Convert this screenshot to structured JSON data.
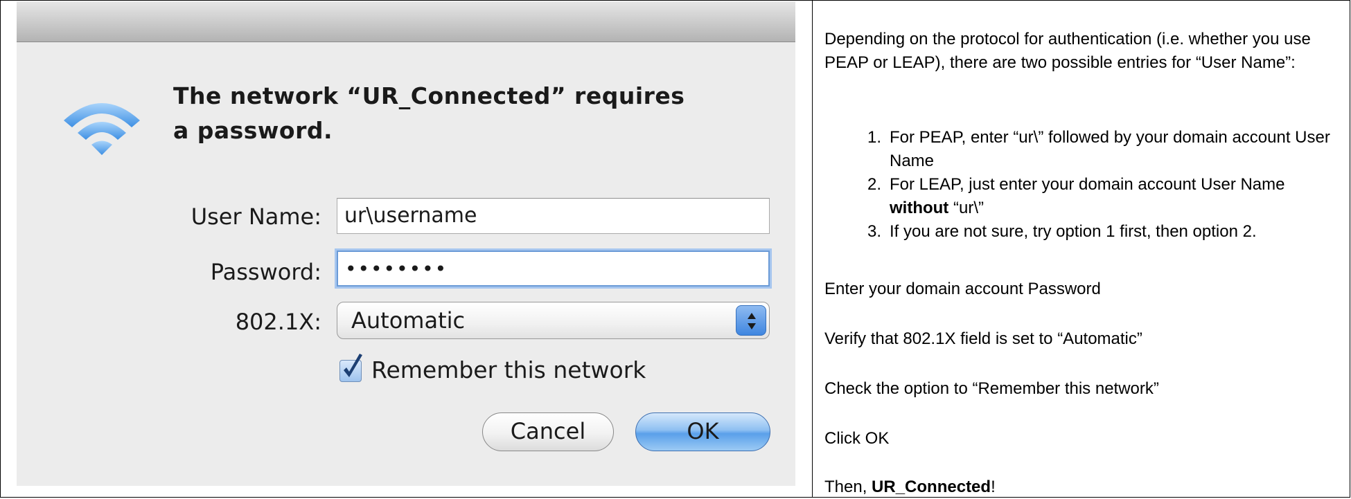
{
  "dialog": {
    "title": "The network “UR_Connected” requires a password.",
    "username_label": "User Name:",
    "username_value": "ur\\username",
    "password_label": "Password:",
    "password_value": "••••••••",
    "dot1x_label": "802.1X:",
    "dot1x_value": "Automatic",
    "remember_label": "Remember this network",
    "remember_checked": true,
    "cancel_label": "Cancel",
    "ok_label": "OK",
    "wifi_icon": "wifi-icon",
    "wifi_color": "#4a9be8"
  },
  "instructions": {
    "intro": "Depending on the protocol for authentication (i.e. whether you use PEAP or LEAP), there are two possible entries for “User Name”:",
    "steps": [
      {
        "num": "1.",
        "text": "For PEAP, enter “ur\\” followed by your domain account User Name"
      },
      {
        "num": "2.",
        "text_before": "For LEAP, just enter your domain account User Name ",
        "bold": "without",
        "text_after": " “ur\\”"
      },
      {
        "num": "3.",
        "text": "If you are not sure, try option 1 first, then option 2."
      }
    ],
    "password_note": "Enter your domain account Password",
    "dot1x_note": "Verify that 802.1X field is set to “Automatic”",
    "remember_note": "Check the option to “Remember this network”",
    "click_note": "Click OK",
    "final_prefix": "Then, ",
    "final_bold": "UR_Connected",
    "final_suffix": "!"
  }
}
